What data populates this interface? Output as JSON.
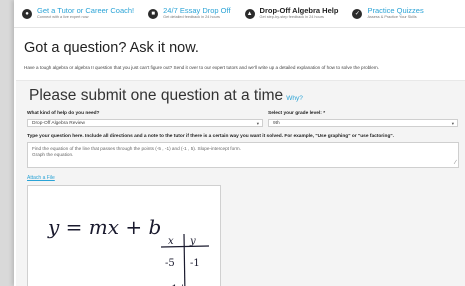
{
  "nav": [
    {
      "title": "Get a Tutor or Career Coach!",
      "sub": "Connect with a live expert now",
      "icon": "person-icon",
      "style": "link"
    },
    {
      "title": "24/7 Essay Drop Off",
      "sub": "Get detailed feedback in 24 hours",
      "icon": "document-icon",
      "style": "link"
    },
    {
      "title": "Drop-Off Algebra Help",
      "sub": "Get step-by-step feedback in 24 hours",
      "icon": "algebra-icon",
      "style": "dark"
    },
    {
      "title": "Practice Quizzes",
      "sub": "Assess & Practice Your Skills",
      "icon": "quiz-icon",
      "style": "link"
    }
  ],
  "heading": "Got a question? Ask it now.",
  "intro": "Have a tough algebra or algebra II question that you just can't figure out? Send it over to our expert tutors and we'll write up a detailed explanation of how to solve the problem.",
  "form": {
    "title": "Please submit one question at a time",
    "why": "Why?",
    "help_label": "What kind of help do you need?",
    "help_value": "Drop-Off Algebra Review",
    "grade_label": "Select your grade level: *",
    "grade_value": "9th",
    "question_label": "Type your question here. Include all directions and a note to the tutor if there is a certain way you want it solved. For example, \"Use graphing\" or \"use factoring\".",
    "question_line1": "Find the equation of the line that passes through the points (-5 , -1) and (-1 , 5). Slope-intercept form.",
    "question_line2": "Graph the equation.",
    "attach": "Attach a File",
    "sketch_equation": "y = mx + b",
    "sketch_table_x": "x",
    "sketch_table_y": "y",
    "sketch_row1_x": "-5",
    "sketch_row1_y": "-1"
  }
}
